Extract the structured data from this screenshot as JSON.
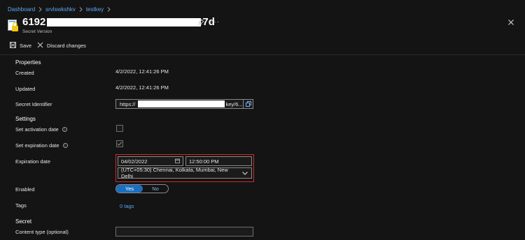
{
  "breadcrumb": {
    "items": [
      "Dashboard",
      "srvlswkshkv",
      "testkey"
    ]
  },
  "header": {
    "title_start": "6192",
    "title_end": "7d",
    "subtitle": "Secret Version",
    "more_glyph": "···",
    "icons": [
      "key-vault-secret-icon",
      "pin-icon",
      "more-icon",
      "close-icon"
    ]
  },
  "toolbar": {
    "save_label": "Save",
    "discard_label": "Discard changes",
    "icons": [
      "save-icon",
      "discard-x-icon"
    ]
  },
  "properties": {
    "section_title": "Properties",
    "created_label": "Created",
    "created_value": "4/2/2022, 12:41:26 PM",
    "updated_label": "Updated",
    "updated_value": "4/2/2022, 12:41:26 PM",
    "secret_identifier_label": "Secret Identifier",
    "secret_identifier_prefix": "https://",
    "secret_identifier_suffix": "key/6..."
  },
  "settings": {
    "section_title": "Settings",
    "activation_label": "Set activation date",
    "activation_checked": false,
    "expiration_label": "Set expiration date",
    "expiration_checked": true,
    "expiration_date_label": "Expiration date",
    "expiration_date_value": "04/02/2022",
    "expiration_time_value": "12:50:00 PM",
    "timezone_value": "(UTC+05:30) Chennai, Kolkata, Mumbai, New Delhi",
    "enabled_label": "Enabled",
    "enabled_yes": "Yes",
    "enabled_no": "No",
    "enabled_selected": "Yes",
    "tags_label": "Tags",
    "tags_value": "0 tags"
  },
  "secret": {
    "section_title": "Secret",
    "content_type_label": "Content type (optional)",
    "content_type_value": ""
  },
  "colors": {
    "background": "#141414",
    "link": "#5aa8f0",
    "highlight_border": "#d22a2a",
    "toggle_active": "#1a6fbf"
  }
}
